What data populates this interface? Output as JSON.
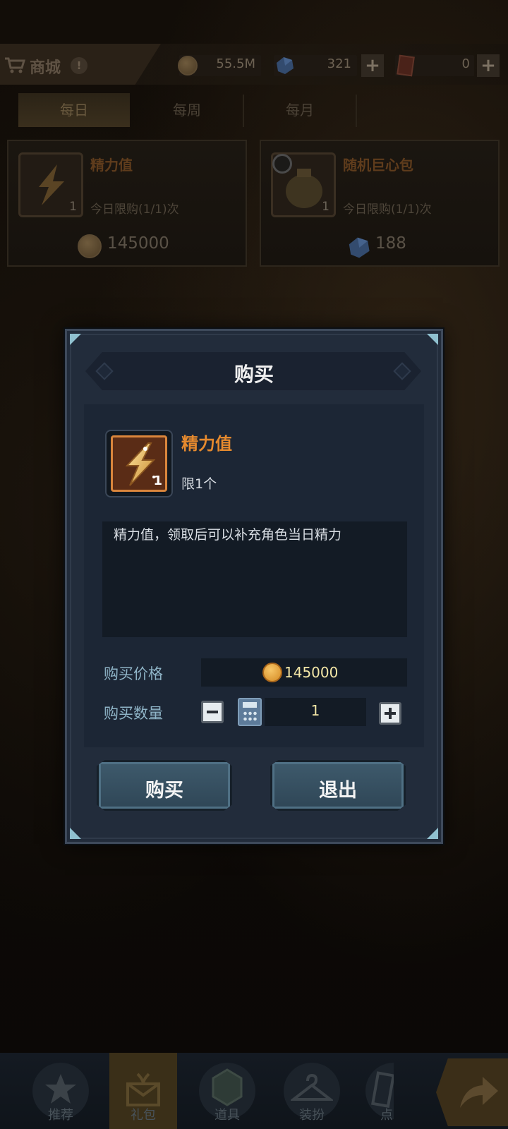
{
  "header": {
    "shop_title": "商城",
    "help_icon": "question-icon",
    "coins": "55.5M",
    "gems": "321",
    "tickets": "0"
  },
  "tabs": [
    {
      "label": "每日",
      "active": true
    },
    {
      "label": "每周",
      "active": false
    },
    {
      "label": "每月",
      "active": false
    }
  ],
  "cards": [
    {
      "name": "精力值",
      "count": "1",
      "limit": "今日限购(1/1)次",
      "price": "145000",
      "currency": "coin-icon"
    },
    {
      "name": "随机巨心包",
      "count": "1",
      "limit": "今日限购(1/1)次",
      "price": "188",
      "currency": "gem-icon"
    }
  ],
  "modal": {
    "title": "购买",
    "item_name": "精力值",
    "item_count": "1",
    "item_limit": "限1个",
    "description": "精力值，领取后可以补充角色当日精力",
    "price_label": "购买价格",
    "price_value": "145000",
    "quantity_label": "购买数量",
    "quantity_value": "1",
    "buy_label": "购买",
    "exit_label": "退出"
  },
  "bottom_nav": [
    {
      "label": "推荐",
      "icon": "star-icon"
    },
    {
      "label": "礼包",
      "icon": "gift-icon",
      "active": true
    },
    {
      "label": "道具",
      "icon": "hexagon-icon"
    },
    {
      "label": "装扮",
      "icon": "hanger-icon"
    },
    {
      "label": "点",
      "icon": "card-icon"
    }
  ],
  "colors": {
    "accent_orange": "#e68a2e",
    "panel_bg": "#222c3b",
    "price_text": "#f3e6a6"
  }
}
